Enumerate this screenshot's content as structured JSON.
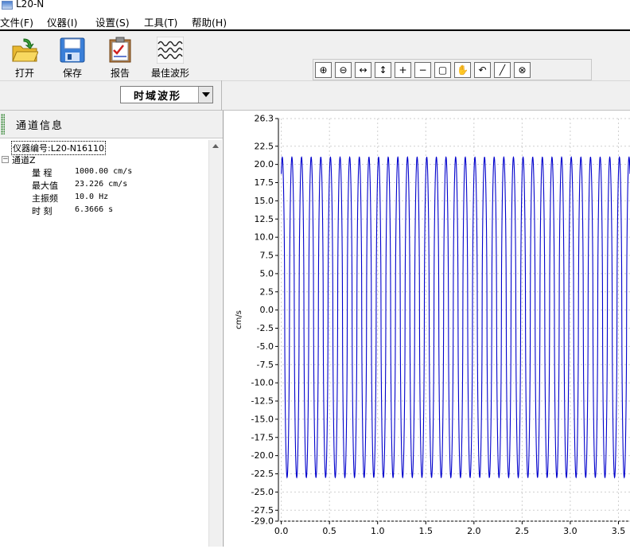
{
  "window": {
    "title": "L20-N"
  },
  "menu": [
    "文件(F)",
    "仪器(I)",
    "设置(S)",
    "工具(T)",
    "帮助(H)"
  ],
  "toolbar": {
    "buttons": [
      {
        "label": "打开",
        "icon": "open-folder-icon"
      },
      {
        "label": "保存",
        "icon": "floppy-save-icon"
      },
      {
        "label": "报告",
        "icon": "report-clipboard-icon"
      },
      {
        "label": "最佳波形",
        "icon": "wave-icon"
      }
    ],
    "chart_tools": [
      "zoom-in-icon",
      "zoom-out-icon",
      "zoom-x-icon",
      "zoom-y-icon",
      "zoom-plus-icon",
      "zoom-minus-icon",
      "zoom-region-icon",
      "pan-hand-icon",
      "undo-arrow-icon",
      "line-graph-icon",
      "reset-zoom-icon"
    ]
  },
  "mode_select": {
    "value": "时域波形"
  },
  "panel": {
    "title": "通道信息",
    "device_label": "仪器编号:L20-N16110",
    "channel_label": "通道Z",
    "fields": [
      {
        "name": "量  程",
        "value": "1000.00 cm/s"
      },
      {
        "name": "最大值",
        "value": "23.226 cm/s"
      },
      {
        "name": "主振频",
        "value": "10.0 Hz"
      },
      {
        "name": "时  刻",
        "value": "6.3666 s"
      }
    ]
  },
  "chart_data": {
    "type": "line",
    "ylabel": "cm/s",
    "xlabel": "",
    "y_ticks": [
      "26.3",
      "22.5",
      "20.0",
      "17.5",
      "15.0",
      "12.5",
      "10.0",
      "7.5",
      "5.0",
      "2.5",
      "0.0",
      "-2.5",
      "-5.0",
      "-7.5",
      "-10.0",
      "-12.5",
      "-15.0",
      "-17.5",
      "-20.0",
      "-22.5",
      "-25.0",
      "-27.5",
      "-29.0"
    ],
    "x_ticks": [
      "0.0",
      "0.5",
      "1.0",
      "1.5",
      "2.0",
      "2.5",
      "3.0",
      "3.5"
    ],
    "xlim": [
      -0.03,
      3.62
    ],
    "ylim": [
      -29.0,
      26.3
    ],
    "grid": true,
    "series": [
      {
        "color": "#0000cc",
        "frequency_hz": 10.0,
        "amplitude": 21.0,
        "min": -23.0,
        "x_start": 0.0,
        "x_end": 3.62
      }
    ]
  }
}
